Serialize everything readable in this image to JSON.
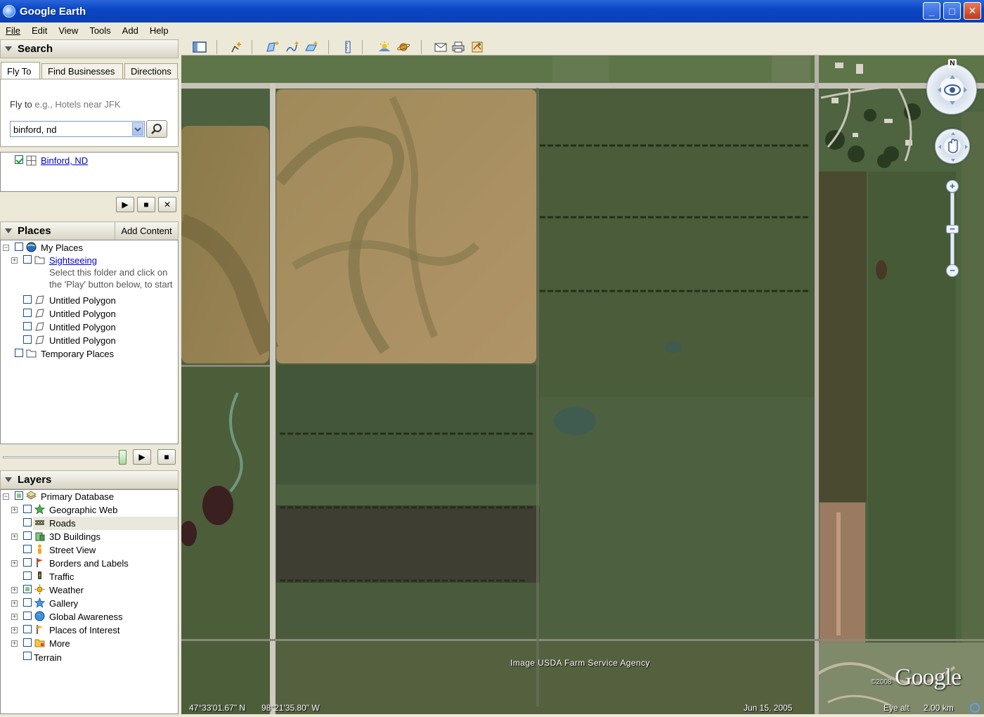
{
  "window": {
    "title": "Google Earth",
    "minimize": "_",
    "maximize": "□",
    "close": "✕"
  },
  "menu": [
    "File",
    "Edit",
    "View",
    "Tools",
    "Add",
    "Help"
  ],
  "search": {
    "heading": "Search",
    "tabs": [
      "Fly To",
      "Find Businesses",
      "Directions"
    ],
    "fly_to_label": "Fly to",
    "fly_to_hint": "e.g., Hotels near JFK",
    "input_value": "binford, nd",
    "result": "Binford, ND"
  },
  "places": {
    "heading": "Places",
    "add_content": "Add Content",
    "items": [
      {
        "label": "My Places"
      },
      {
        "label": "Sightseeing"
      },
      {
        "label": "Select this folder and click on"
      },
      {
        "label": "the 'Play' button below, to start"
      },
      {
        "label": "Untitled Polygon"
      },
      {
        "label": "Untitled Polygon"
      },
      {
        "label": "Untitled Polygon"
      },
      {
        "label": "Untitled Polygon"
      },
      {
        "label": "Temporary Places"
      }
    ]
  },
  "layers": {
    "heading": "Layers",
    "items": [
      {
        "label": "Primary Database",
        "icon": "database-icon"
      },
      {
        "label": "Geographic Web",
        "icon": "star-icon"
      },
      {
        "label": "Roads",
        "icon": "road-icon"
      },
      {
        "label": "3D Buildings",
        "icon": "building-icon"
      },
      {
        "label": "Street View",
        "icon": "pegman-icon"
      },
      {
        "label": "Borders and Labels",
        "icon": "flag-icon"
      },
      {
        "label": "Traffic",
        "icon": "traffic-light-icon"
      },
      {
        "label": "Weather",
        "icon": "sun-icon"
      },
      {
        "label": "Gallery",
        "icon": "star-icon"
      },
      {
        "label": "Global Awareness",
        "icon": "globe-icon"
      },
      {
        "label": "Places of Interest",
        "icon": "flag-icon"
      },
      {
        "label": "More",
        "icon": "folder-icon"
      },
      {
        "label": "Terrain",
        "icon": ""
      }
    ]
  },
  "map": {
    "attribution": "Image USDA Farm Service Agency",
    "copyright": "©2008",
    "logo": "Google",
    "compass_north": "N"
  },
  "status": {
    "latitude": "47°33'01.67\" N",
    "longitude": "98°21'35.80\" W",
    "date": "Jun 15, 2005",
    "eye_alt_label": "Eye alt",
    "eye_alt_value": "2.00 km"
  }
}
